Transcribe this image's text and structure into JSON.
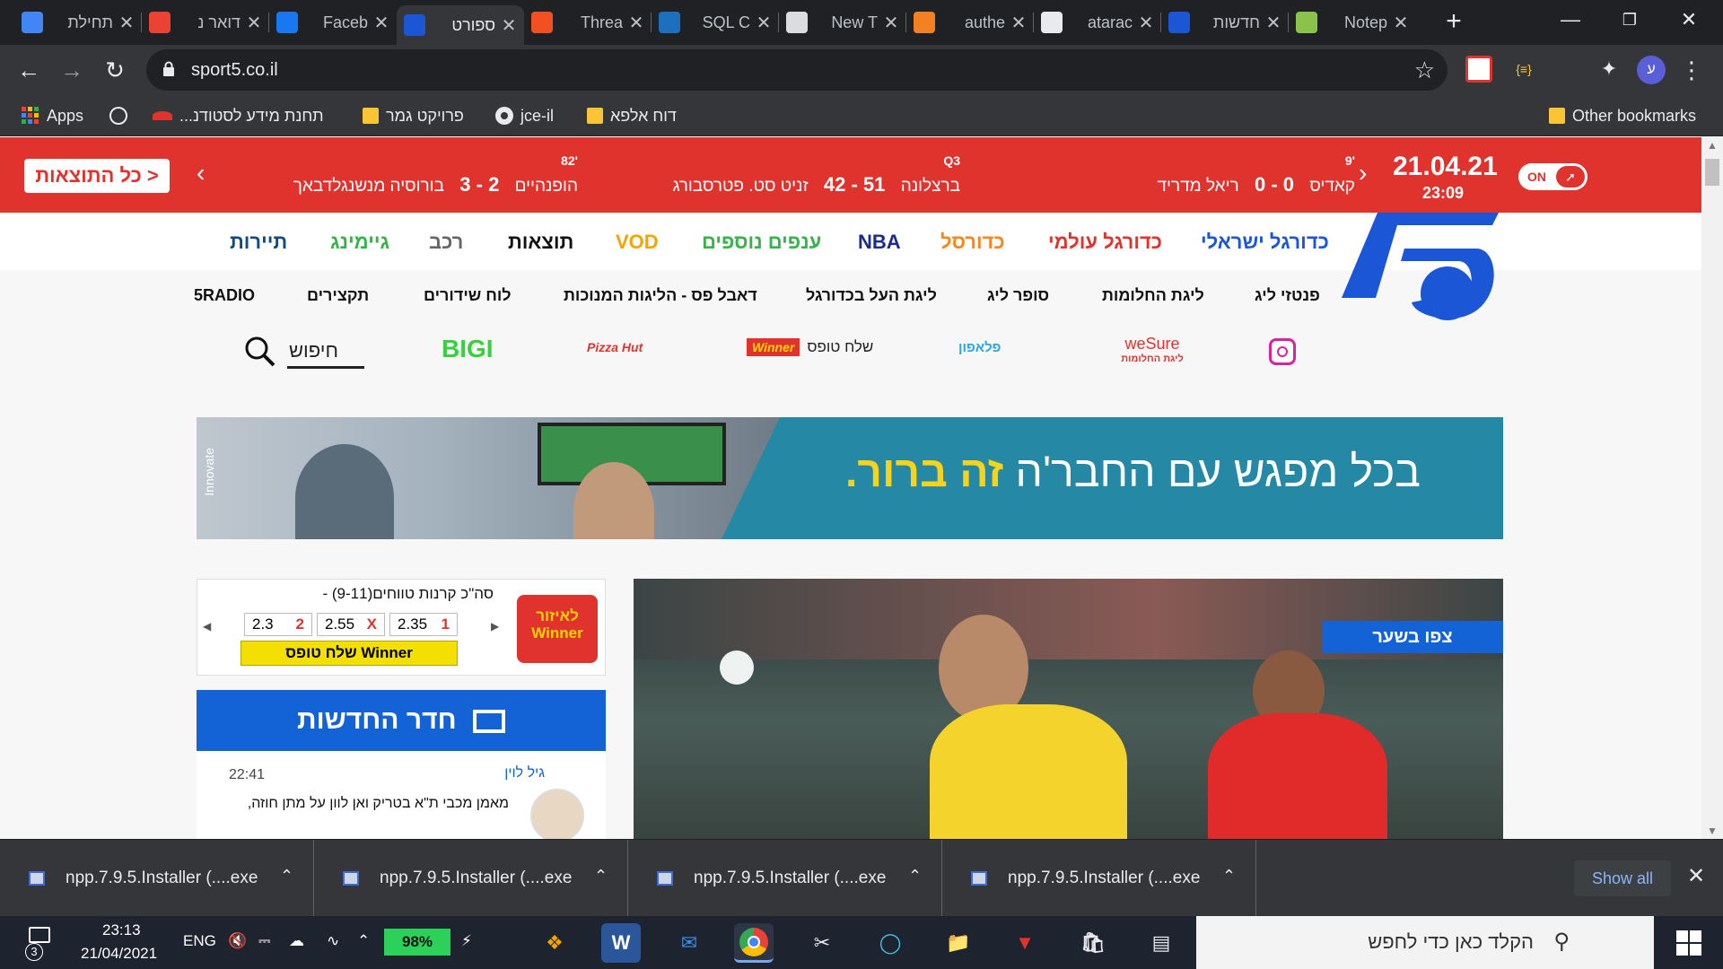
{
  "browser": {
    "tabs": [
      {
        "title": "תחילת",
        "icon": "google-docs-icon",
        "color": "#4285f4",
        "active": false
      },
      {
        "title": "דואר נ",
        "icon": "gmail-icon",
        "color": "#ea4335",
        "active": false
      },
      {
        "title": "Faceb",
        "icon": "facebook-icon",
        "color": "#1877f2",
        "active": false
      },
      {
        "title": "ספורט",
        "icon": "sport5-icon",
        "color": "#1a56d6",
        "active": true
      },
      {
        "title": "Threa",
        "icon": "microsoft-icon",
        "color": "#f25022",
        "active": false
      },
      {
        "title": "SQL C",
        "icon": "sql-icon",
        "color": "#1f6fbf",
        "active": false
      },
      {
        "title": "New T",
        "icon": "new-tab-icon",
        "color": "#dadce0",
        "active": false
      },
      {
        "title": "authe",
        "icon": "stackoverflow-icon",
        "color": "#f48024",
        "active": false
      },
      {
        "title": "atarac",
        "icon": "github-icon",
        "color": "#e8eaed",
        "active": false
      },
      {
        "title": "חדשות",
        "icon": "news-icon",
        "color": "#1a56d6",
        "active": false
      },
      {
        "title": "Notep",
        "icon": "notepad-icon",
        "color": "#8bc34a",
        "active": false
      }
    ],
    "url": "sport5.co.il",
    "profile_initial": "ע",
    "bookmarks": [
      {
        "label": "Apps",
        "icon": "apps-grid-icon"
      },
      {
        "label": "",
        "icon": "globe-icon"
      },
      {
        "label": "תחנת מידע לסטודנ...",
        "icon": "bookmark-logo-icon"
      },
      {
        "label": "פרויקט גמר",
        "icon": "folder-icon"
      },
      {
        "label": "jce-il",
        "icon": "github-icon"
      },
      {
        "label": "דוח אלפא",
        "icon": "folder-icon"
      }
    ],
    "other_bookmarks": "Other bookmarks"
  },
  "ticker": {
    "all_results": "כל התוצאות >",
    "date": "21.04.21",
    "time": "23:09",
    "toggle": "ON",
    "matches": [
      {
        "minute": "'9",
        "home": "קאדיס",
        "score": "0 - 0",
        "away": "ריאל מדריד"
      },
      {
        "minute": "Q3",
        "home": "ברצלונה",
        "score": "51 - 42",
        "away": "זניט סט. פטרסבורג"
      },
      {
        "minute": "'82",
        "home": "הופנהיים",
        "score": "2 - 3",
        "away": "בורוסיה מנשנגלדבאך"
      }
    ]
  },
  "site": {
    "main_nav": [
      {
        "label": "כדורגל ישראלי",
        "color": "#1a56d6"
      },
      {
        "label": "כדורגל עולמי",
        "color": "#e1332e"
      },
      {
        "label": "כדורסל",
        "color": "#f7861b"
      },
      {
        "label": "NBA",
        "color": "#1a2b8f"
      },
      {
        "label": "ענפים נוספים",
        "color": "#37b34a"
      },
      {
        "label": "VOD",
        "color": "#f5a400"
      },
      {
        "label": "תוצאות",
        "color": "#111111"
      },
      {
        "label": "רכב",
        "color": "#666666"
      },
      {
        "label": "גיימינג",
        "color": "#37b34a"
      },
      {
        "label": "תיירות",
        "color": "#0f4c81"
      }
    ],
    "sub_nav": [
      "פנטזי ליג",
      "ליגת החלומות",
      "סופר ליג",
      "ליגת העל בכדורגל",
      "דאבל פס - הליגות המנוכות",
      "לוח שידורים",
      "תקצירים",
      "5RADIO"
    ],
    "sponsors": [
      {
        "label": "",
        "icon": "instagram-icon"
      },
      {
        "label": "weSure",
        "sub": "ליגת החלומות",
        "icon": "wesure-logo"
      },
      {
        "label": "פלאפון",
        "icon": "pelephone-logo"
      },
      {
        "label": "שלח טופס",
        "brand": "Winner",
        "icon": "winner-logo"
      },
      {
        "label": "Pizza Hut",
        "icon": "pizzahut-logo"
      },
      {
        "label": "BIGI",
        "icon": "bigi-logo"
      }
    ],
    "search_label": "חיפוש",
    "banner": {
      "text": "בכל מפגש עם החבר'ה",
      "highlight": "זה ברור.",
      "tag": "Innovate"
    },
    "bet": {
      "logo": "לאיזור Winner",
      "title": "סה\"כ קרנות טווחים(9-11) -",
      "odds": [
        {
          "label": "1",
          "value": "2.35"
        },
        {
          "label": "X",
          "value": "2.55"
        },
        {
          "label": "2",
          "value": "2.3"
        }
      ],
      "button": "שלח טופס Winner"
    },
    "newsroom": {
      "title": "חדר החדשות",
      "time": "22:41",
      "author": "גיל לוין",
      "text": "מאמן מכבי ת\"א בטריק ואן לוון על מתן חוזה,"
    },
    "hero_badge": "צפו בשער"
  },
  "downloads": {
    "items": [
      "npp.7.9.5.Installer (....exe",
      "npp.7.9.5.Installer (....exe",
      "npp.7.9.5.Installer (....exe",
      "npp.7.9.5.Installer (....exe"
    ],
    "show_all": "Show all"
  },
  "taskbar": {
    "search_placeholder": "הקלד כאן כדי לחפש",
    "language": "ENG",
    "battery": "98%",
    "time": "23:13",
    "date": "21/04/2021",
    "notifications": "3"
  }
}
